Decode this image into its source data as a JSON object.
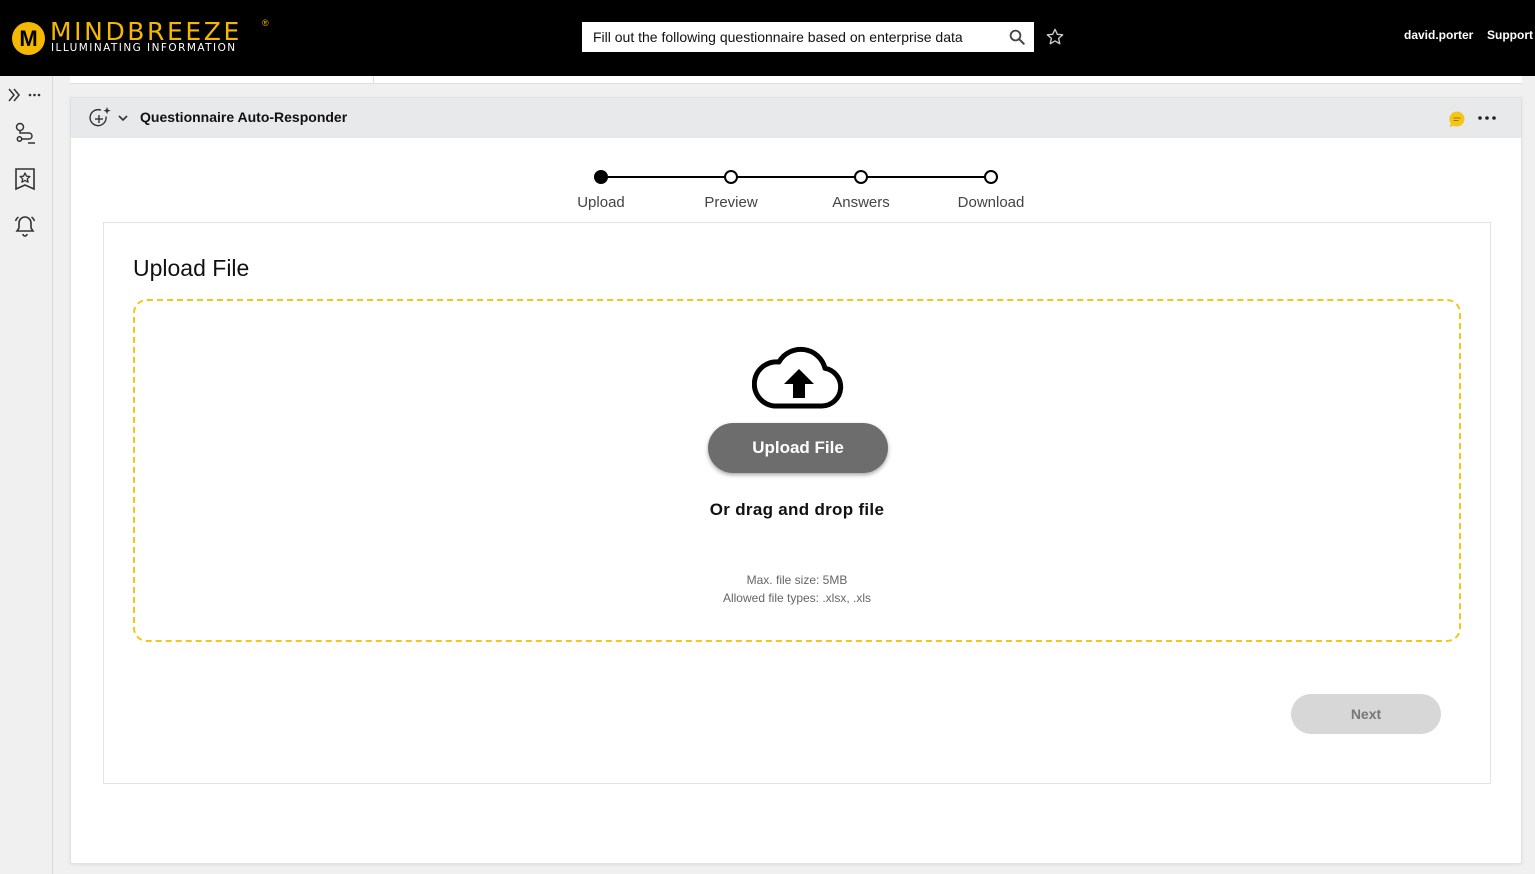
{
  "header": {
    "logo_letter": "M",
    "brand": "MINDBREEZE",
    "brand_reg": "®",
    "tagline": "ILLUMINATING INFORMATION",
    "search_value": "Fill out the following questionnaire based on enterprise data",
    "user": "david.porter",
    "support": "Support",
    "brand_color": "#f5b800"
  },
  "sidebar": {
    "items": [
      {
        "icon": "expand-more-icon"
      },
      {
        "icon": "route-icon"
      },
      {
        "icon": "bookmark-star-icon"
      },
      {
        "icon": "bell-icon"
      }
    ]
  },
  "widget": {
    "title": "Questionnaire Auto-Responder"
  },
  "stepper": {
    "steps": [
      {
        "label": "Upload",
        "active": true
      },
      {
        "label": "Preview",
        "active": false
      },
      {
        "label": "Answers",
        "active": false
      },
      {
        "label": "Download",
        "active": false
      }
    ]
  },
  "panel": {
    "title": "Upload File",
    "upload_button": "Upload File",
    "drag_text": "Or drag and drop file",
    "max_size": "Max. file size: 5MB",
    "allowed_types": "Allowed file types: .xlsx, .xls",
    "next_button": "Next",
    "dropzone_color": "#f5c518"
  }
}
